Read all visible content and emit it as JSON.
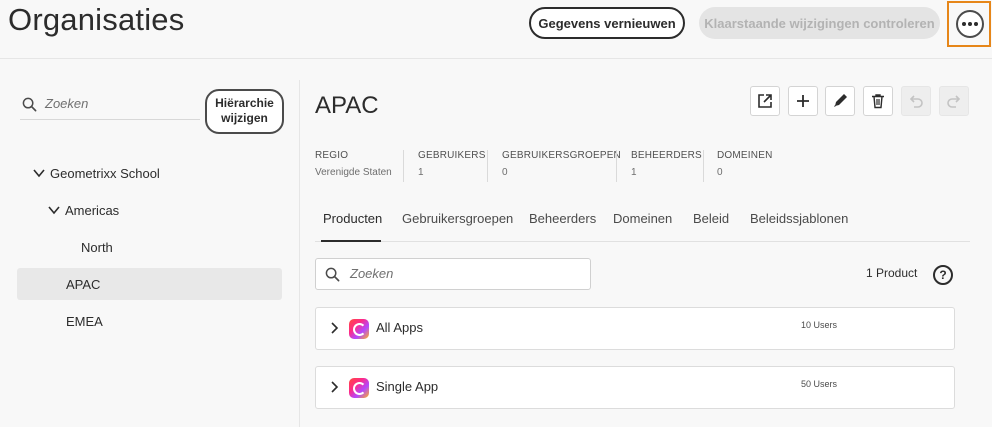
{
  "page": {
    "title": "Organisaties"
  },
  "header": {
    "refresh_label": "Gegevens vernieuwen",
    "review_label": "Klaarstaande wijzigingen controleren",
    "more_icon": "more-icon"
  },
  "sidebar": {
    "search_placeholder": "Zoeken",
    "hierarchy_button": {
      "line1": "Hiërarchie",
      "line2": "wijzigen"
    },
    "tree": [
      {
        "label": "Geometrixx School",
        "expanded": true,
        "level": 0
      },
      {
        "label": "Americas",
        "expanded": true,
        "level": 1
      },
      {
        "label": "North",
        "level": 2
      },
      {
        "label": "APAC",
        "level": 0,
        "selected": true
      },
      {
        "label": "EMEA",
        "level": 0
      }
    ]
  },
  "main": {
    "title": "APAC",
    "toolbar": [
      "open-external-icon",
      "add-icon",
      "edit-icon",
      "delete-icon",
      "undo-icon",
      "redo-icon"
    ],
    "stats": [
      {
        "label": "REGIO",
        "value": "Verenigde Staten"
      },
      {
        "label": "GEBRUIKERS",
        "value": "1"
      },
      {
        "label": "GEBRUIKERSGROEPEN",
        "value": "0"
      },
      {
        "label": "BEHEERDERS",
        "value": "1"
      },
      {
        "label": "DOMEINEN",
        "value": "0"
      }
    ],
    "tabs": [
      {
        "label": "Producten",
        "active": true
      },
      {
        "label": "Gebruikersgroepen"
      },
      {
        "label": "Beheerders"
      },
      {
        "label": "Domeinen"
      },
      {
        "label": "Beleid"
      },
      {
        "label": "Beleidssjablonen"
      }
    ],
    "search_placeholder": "Zoeken",
    "product_count": "1 Product",
    "help_icon": "?",
    "products": [
      {
        "name": "All Apps",
        "users": "10 Users"
      },
      {
        "name": "Single App",
        "users": "50 Users"
      }
    ]
  },
  "colors": {
    "highlight": "#e68619",
    "text": "#2c2c2c",
    "background": "#f8f8f8"
  }
}
